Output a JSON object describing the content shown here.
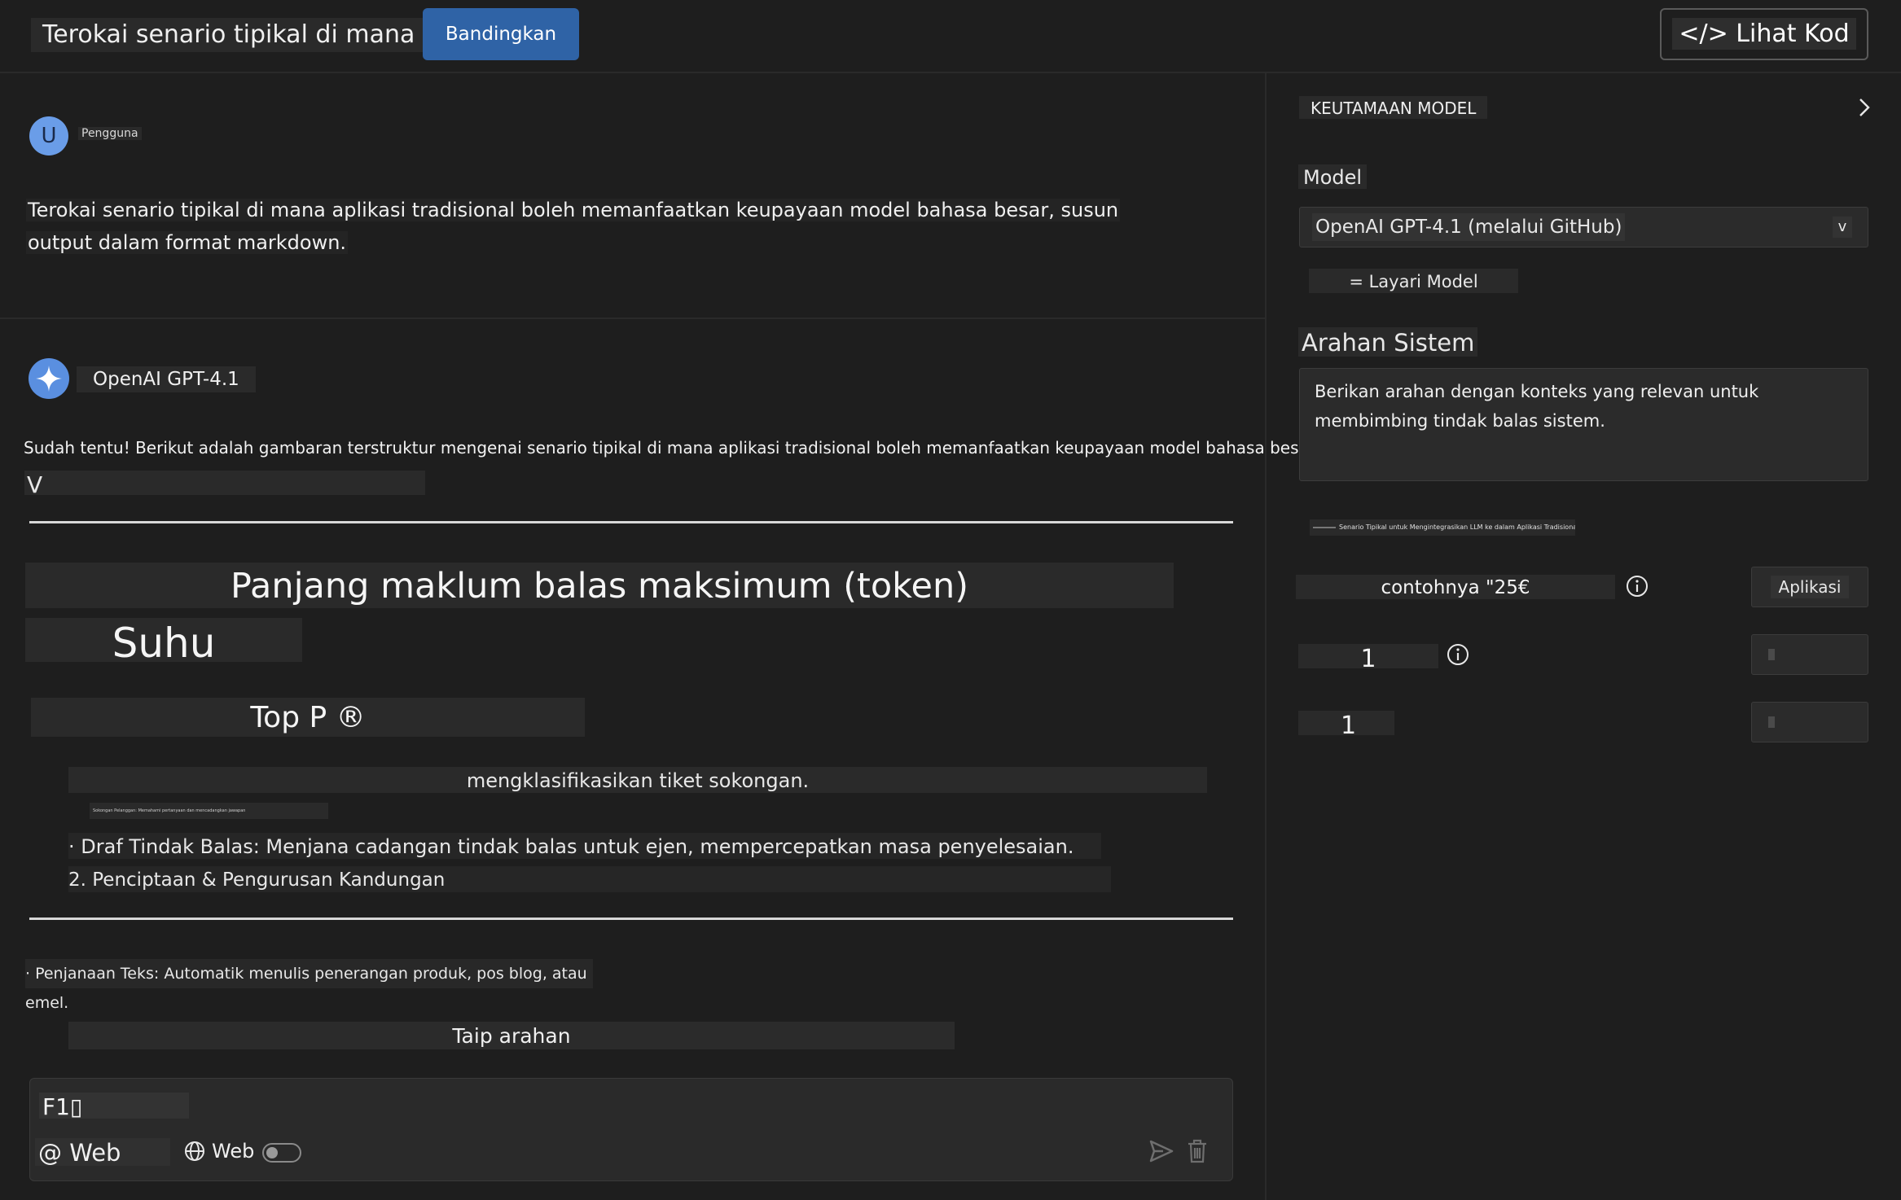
{
  "header": {
    "chat_title": "Terokai senario tipikal di mana ...",
    "compare_label": "Bandingkan",
    "view_code_label": "</> Lihat Kod"
  },
  "user_message": {
    "avatar_letter": "U",
    "author": "Pengguna",
    "line1": "Terokai senario tipikal di mana aplikasi tradisional boleh memanfaatkan keupayaan model bahasa besar, susun",
    "line2": "output dalam format markdown."
  },
  "assistant_message": {
    "model_name": "OpenAI GPT-4.1",
    "intro": "Sudah tentu! Berikut adalah gambaran terstruktur mengenai senario tipikal di mana aplikasi tradisional boleh memanfaatkan keupayaan model bahasa besar (LLM):",
    "marker": "V",
    "heading_max_length": "Panjang maklum balas maksimum (token)",
    "heading_temperature": "Suhu",
    "heading_top_p": "Top P ®",
    "classify_text": "mengklasifikasikan tiket sokongan.",
    "tiny_text": "Sokongan Pelanggan: Memahami pertanyaan dan mencadangkan jawapan",
    "draft_item": "· Draf Tindak Balas: Menjana cadangan tindak balas untuk ejen, mempercepatkan masa penyelesaian.",
    "content_item": "2. Penciptaan & Pengurusan Kandungan",
    "text_gen_item": "· Penjanaan Teks: Automatik menulis penerangan produk, pos blog, atau emel."
  },
  "composer": {
    "prompt_label": "Taip arahan",
    "input_value": "F1▯",
    "web_mention": "@ Web",
    "web_toggle_label": "Web",
    "web_toggle_on": false
  },
  "settings": {
    "section_title": "KEUTAMAAN MODEL",
    "model_label": "Model",
    "model_value": "OpenAI GPT-4.1 (melalui GitHub)",
    "model_caret": "v",
    "browse_models": "= Layari Model",
    "system_label": "Arahan Sistem",
    "system_text": "Berikan arahan dengan konteks yang relevan untuk membimbing tindak balas sistem.",
    "scenario_tiny": "Senario Tipikal untuk Mengintegrasikan LLM ke dalam Aplikasi Tradisional",
    "max_length_placeholder": "contohnya \"25€",
    "apply_label": "Aplikasi",
    "temperature_value": "1",
    "top_p_value": "1"
  },
  "colors": {
    "background": "#1e1e1e",
    "accent": "#2f63a6",
    "avatar_user": "#6a9de8",
    "avatar_ai": "#5a8fe0"
  }
}
